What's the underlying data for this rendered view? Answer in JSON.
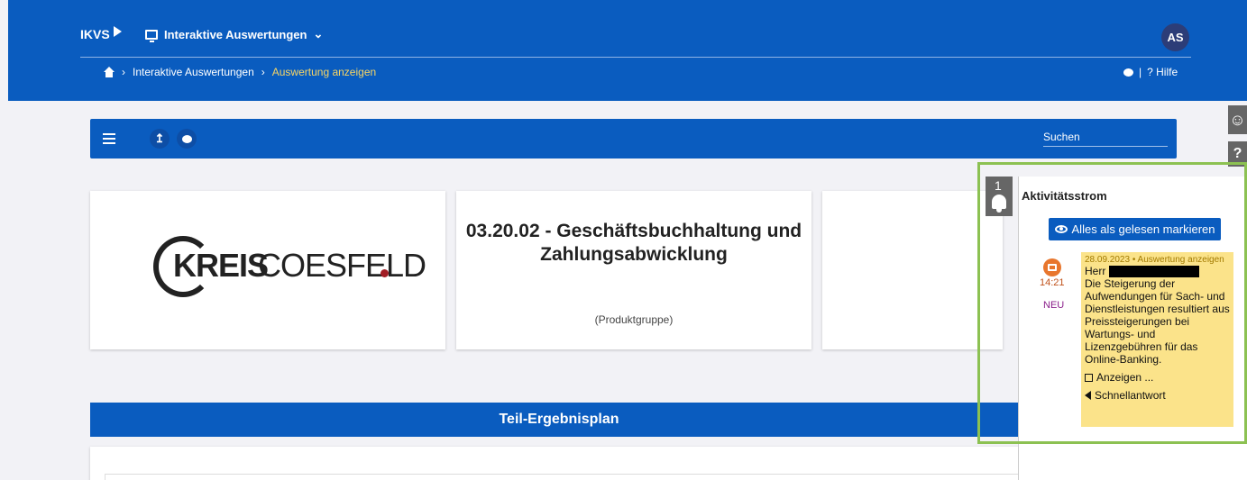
{
  "header": {
    "brand": "IKVS",
    "app_name": "Interaktive Auswertungen",
    "avatar_initials": "AS",
    "breadcrumb": [
      "Interaktive Auswertungen",
      "Auswertung anzeigen"
    ],
    "help_separator": "|",
    "help_label": "? Hilfe"
  },
  "toolbar": {
    "upload_icon": "↥",
    "search_placeholder": "Suchen"
  },
  "cards": {
    "logo": {
      "kreis": "KREIS",
      "coesfeld": "COESFELD"
    },
    "product_title": "03.20.02 - Geschäftsbuchhaltung und Zahlungsabwicklung",
    "product_subtitle": "(Produktgruppe)"
  },
  "section": {
    "title": "Teil-Ergebnisplan"
  },
  "sidebar": {
    "help_label": "?"
  },
  "activity": {
    "badge_count": "1",
    "title": "Aktivitätsstrom",
    "mark_all_label": "Alles als gelesen markieren",
    "item": {
      "time": "14:21",
      "status": "NEU",
      "meta": "28.09.2023 • Auswertung anzeigen",
      "salutation": "Herr",
      "message": "Die Steigerung der Aufwendungen für Sach- und Dienstleistungen resultiert aus Preissteigerungen bei Wartungs- und Lizenzgebühren für das Online-Banking.",
      "open_label": "Anzeigen ...",
      "reply_label": "Schnellantwort"
    }
  },
  "colors": {
    "primary": "#0a5cbf",
    "accent": "#f7d565",
    "highlight": "#8cc152",
    "note": "#fbe38a"
  }
}
